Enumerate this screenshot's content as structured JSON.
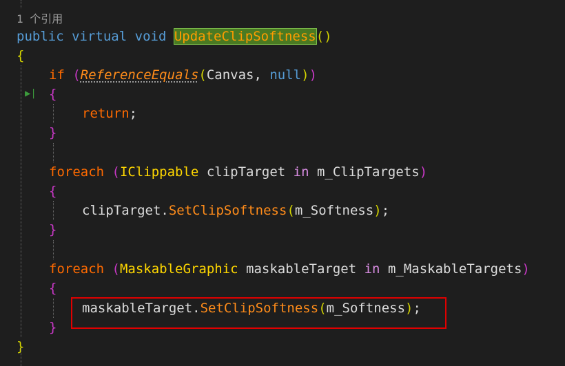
{
  "codelens": "1 个引用",
  "code": {
    "decl_public": "public",
    "decl_virtual": "virtual",
    "decl_void": "void",
    "method_name": "UpdateClipSoftness",
    "decl_parens": "()",
    "open_brace": "{",
    "close_brace": "}",
    "if_kw": "if",
    "if_open": "(",
    "refeq": "ReferenceEquals",
    "refeq_open": "(",
    "refeq_args_a": "Canvas, ",
    "refeq_null": "null",
    "refeq_close": ")",
    "if_close": ")",
    "return_kw": "return",
    "semicolon": ";",
    "foreach_kw": "foreach",
    "paren_open": "(",
    "paren_close": ")",
    "iclippable": "IClippable",
    "clip_var": " clipTarget ",
    "in_kw": "in",
    "clip_coll": " m_ClipTargets",
    "clip_call_obj": "clipTarget.",
    "set_clip": "SetClipSoftness",
    "call_open": "(",
    "call_arg": "m_Softness",
    "call_close": ")",
    "maskable_type": "MaskableGraphic",
    "mask_var": " maskableTarget ",
    "mask_coll": " m_MaskableTargets",
    "mask_call_obj": "maskableTarget."
  },
  "gutter_marker": "▶|",
  "colors": {
    "background": "#1e1e1e",
    "keyword": "#569cd6",
    "control_keyword": "#ff6a00",
    "method": "#ff8c1a",
    "type": "#ffd700",
    "highlight_border": "#e00000"
  }
}
